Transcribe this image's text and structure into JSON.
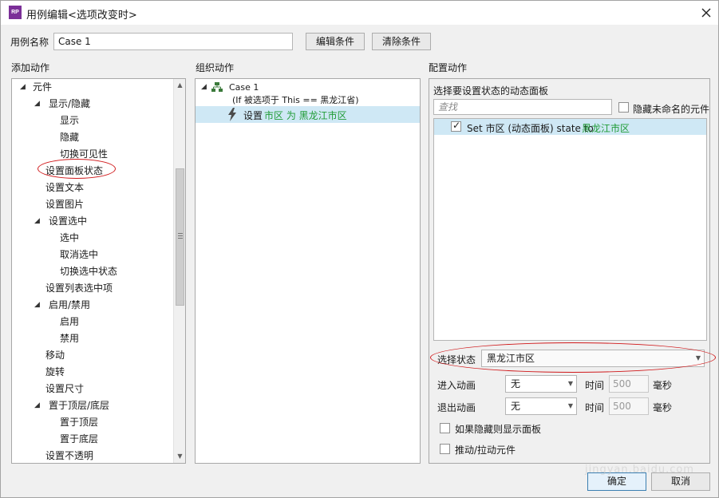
{
  "window": {
    "title": "用例编辑<选项改变时>",
    "icon_text": "RP"
  },
  "case_name": {
    "label": "用例名称",
    "value": "Case 1"
  },
  "buttons": {
    "edit_condition": "编辑条件",
    "clear_condition": "清除条件",
    "ok": "确定",
    "cancel": "取消"
  },
  "headers": {
    "add_action": "添加动作",
    "organize_action": "组织动作",
    "configure_action": "配置动作"
  },
  "add_tree": [
    {
      "label": "元件",
      "level": 0,
      "toggle": "◢"
    },
    {
      "label": "显示/隐藏",
      "level": 1,
      "toggle": "◢"
    },
    {
      "label": "显示",
      "level": 2
    },
    {
      "label": "隐藏",
      "level": 2
    },
    {
      "label": "切换可见性",
      "level": 2
    },
    {
      "label": "设置面板状态",
      "level": 1
    },
    {
      "label": "设置文本",
      "level": 1
    },
    {
      "label": "设置图片",
      "level": 1
    },
    {
      "label": "设置选中",
      "level": 1,
      "toggle": "◢"
    },
    {
      "label": "选中",
      "level": 2
    },
    {
      "label": "取消选中",
      "level": 2
    },
    {
      "label": "切换选中状态",
      "level": 2
    },
    {
      "label": "设置列表选中项",
      "level": 1
    },
    {
      "label": "启用/禁用",
      "level": 1,
      "toggle": "◢"
    },
    {
      "label": "启用",
      "level": 2
    },
    {
      "label": "禁用",
      "level": 2
    },
    {
      "label": "移动",
      "level": 1
    },
    {
      "label": "旋转",
      "level": 1
    },
    {
      "label": "设置尺寸",
      "level": 1
    },
    {
      "label": "置于顶层/底层",
      "level": 1,
      "toggle": "◢"
    },
    {
      "label": "置于顶层",
      "level": 2
    },
    {
      "label": "置于底层",
      "level": 2
    },
    {
      "label": "设置不透明",
      "level": 1
    }
  ],
  "organize": {
    "case_title": "Case 1",
    "case_condition": "(If 被选项于 This == 黑龙江省)",
    "action_prefix": "设置",
    "action_target": "市区 为 黑龙江市区"
  },
  "configure": {
    "panel_label": "选择要设置状态的动态面板",
    "search_placeholder": "查找",
    "hide_unnamed_label": "隐藏未命名的元件",
    "panel_item_text": "Set 市区 (动态面板) state to ",
    "panel_item_state": "黑龙江市区",
    "select_state_label": "选择状态",
    "select_state_value": "黑龙江市区",
    "enter_anim_label": "进入动画",
    "enter_anim_value": "无",
    "exit_anim_label": "退出动画",
    "exit_anim_value": "无",
    "time_label": "时间",
    "time_value": "500",
    "ms_label": "毫秒",
    "show_if_hidden_label": "如果隐藏则显示面板",
    "push_pull_label": "推动/拉动元件"
  },
  "watermark": "jingyan.baidu.com",
  "colors": {
    "accent_green": "#1f9b35",
    "selection": "#cfe8f5",
    "annotation_red": "#d0191b"
  },
  "icons": {
    "close": "close-icon",
    "case": "case-tree-icon",
    "action": "lightning-icon"
  }
}
